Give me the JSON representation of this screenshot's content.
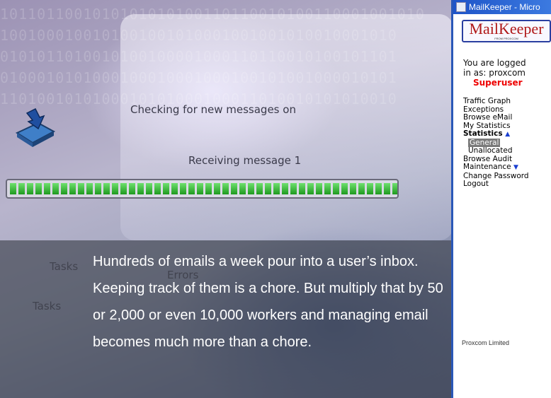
{
  "background": {
    "binary_rows": [
      "1011011001010101010100110110010100110001001010",
      "1001000100101001001010001001001010010001010",
      "0101011010010100100001000110110010100101101",
      "0100010101000100010001000100101001000010101",
      "1101001010100010101000100011010010101010010"
    ],
    "status_checking": "Checking for new messages on",
    "status_receiving": "Receiving message 1",
    "progress_segments": 46,
    "ghost_tasks_label": "Tasks",
    "ghost_errors_label": "Errors",
    "ghost_tasks_tab": "Tasks"
  },
  "window": {
    "title": "MailKeeper - Micro",
    "logo_text": "MailKeeper",
    "logo_sub": "FROM PROXCOM"
  },
  "session": {
    "line1": "You are logged",
    "line2": "in as: proxcom",
    "role": "Superuser"
  },
  "menu": {
    "traffic_graph": "Traffic Graph",
    "exceptions": "Exceptions",
    "browse_email": "Browse eMail",
    "my_statistics": "My Statistics",
    "statistics": "Statistics",
    "general": "General",
    "unallocated": "Unallocated",
    "browse_audit": "Browse Audit",
    "maintenance": "Maintenance",
    "change_password": "Change Password",
    "logout": "Logout"
  },
  "footer": {
    "company": "Proxcom Limited"
  },
  "caption": {
    "line1": "Hundreds of emails a week pour into a user’s inbox.",
    "line2": "Keeping track of them is a chore. But multiply that by 50",
    "line3": "or 2,000 or even 10,000 workers and managing email",
    "line4": "becomes much more than a chore."
  }
}
